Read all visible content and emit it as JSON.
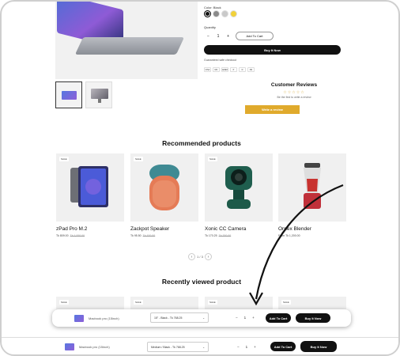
{
  "product": {
    "color_label": "Color: Black",
    "quantity_label": "Quantity",
    "quantity_value": "1",
    "qty_minus": "−",
    "qty_plus": "+",
    "add_to_cart": "Add To Cart",
    "buy_now": "Buy It Now",
    "guarantee": "Guaranteed safe checkout",
    "swatch_colors": [
      "#111111",
      "#8a8a8a",
      "#c9c9c9",
      "#f1d13a"
    ],
    "payment_icons": [
      "VISA",
      "MC",
      "AMEX",
      "P",
      "D",
      "DS"
    ]
  },
  "reviews": {
    "title": "Customer Reviews",
    "stars": "☆☆☆☆☆",
    "subtitle": "Be the first to write a review",
    "write_button": "Write a review"
  },
  "recommended": {
    "title": "Recommended products",
    "pager": "1 / 3",
    "products": [
      {
        "sale": "SALE",
        "name": "zPad Pro M.2",
        "price": "Tk 809.00",
        "old_price": "Tk 1,000.00"
      },
      {
        "sale": "SALE",
        "name": "Zackpot Speaker",
        "price": "Tk 95.50",
        "old_price": "Tk 100.00"
      },
      {
        "sale": "SALE",
        "name": "Xonic CC Camera",
        "price": "Tk 170.25",
        "old_price": "Tk 200.00"
      },
      {
        "sale": "",
        "name": "Ornex Blender",
        "price": "From Tk 1,200.00",
        "old_price": ""
      }
    ]
  },
  "recently_viewed": {
    "title": "Recently viewed product",
    "sale": "SALE"
  },
  "sticky_top": {
    "name": "Macbook pro (15inch)",
    "variant": "15\" - Black - Tk 768.25",
    "quantity": "1",
    "add_to_cart": "Add To Cart",
    "buy_now": "Buy It Now"
  },
  "sticky_bottom": {
    "name": "Macbook pro (15inch)",
    "variant": "Medium / Black - Tk 768.25",
    "quantity": "1",
    "add_to_cart": "Add To Cart",
    "buy_now": "Buy It Now"
  }
}
